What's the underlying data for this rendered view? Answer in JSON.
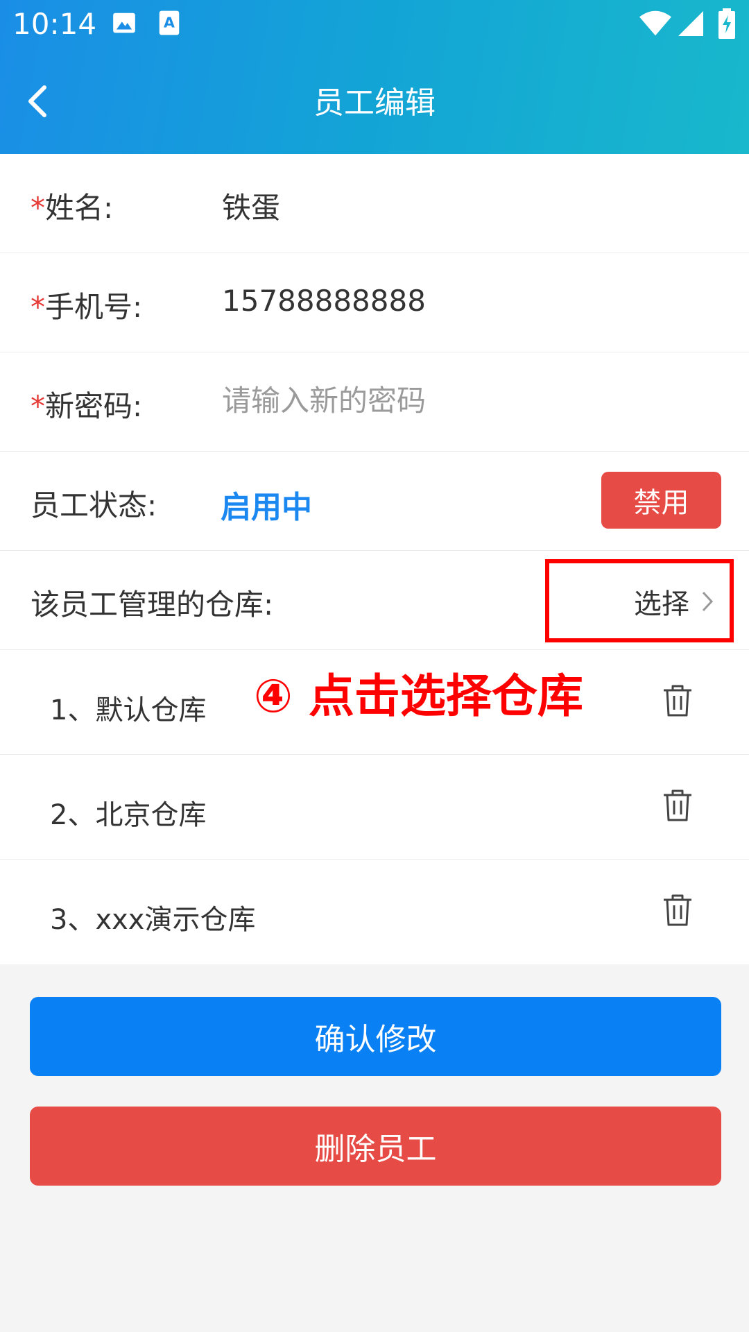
{
  "status_bar": {
    "time": "10:14",
    "icons": [
      "image-icon",
      "a-text-icon",
      "wifi-icon",
      "signal-icon",
      "battery-charging-icon"
    ]
  },
  "nav": {
    "title": "员工编辑",
    "back_icon": "chevron-left-icon"
  },
  "form": {
    "required_mark": "*",
    "name": {
      "label": "姓名:",
      "value": "铁蛋"
    },
    "phone": {
      "label": "手机号:",
      "value": "15788888888"
    },
    "password": {
      "label": "新密码:",
      "placeholder": "请输入新的密码"
    },
    "status": {
      "label": "员工状态:",
      "value": "启用中",
      "button": "禁用"
    },
    "warehouses": {
      "label": "该员工管理的仓库:",
      "select_label": "选择",
      "items": [
        {
          "name": "1、默认仓库"
        },
        {
          "name": "2、北京仓库"
        },
        {
          "name": "3、xxx演示仓库"
        }
      ]
    }
  },
  "annotation": "④ 点击选择仓库",
  "buttons": {
    "confirm": "确认修改",
    "delete": "删除员工"
  },
  "colors": {
    "header_start": "#1a8ee6",
    "header_end": "#19b8cc",
    "primary": "#0a80f5",
    "danger": "#e64b45",
    "status_text": "#1a88f0",
    "annotation": "#ff0000"
  }
}
